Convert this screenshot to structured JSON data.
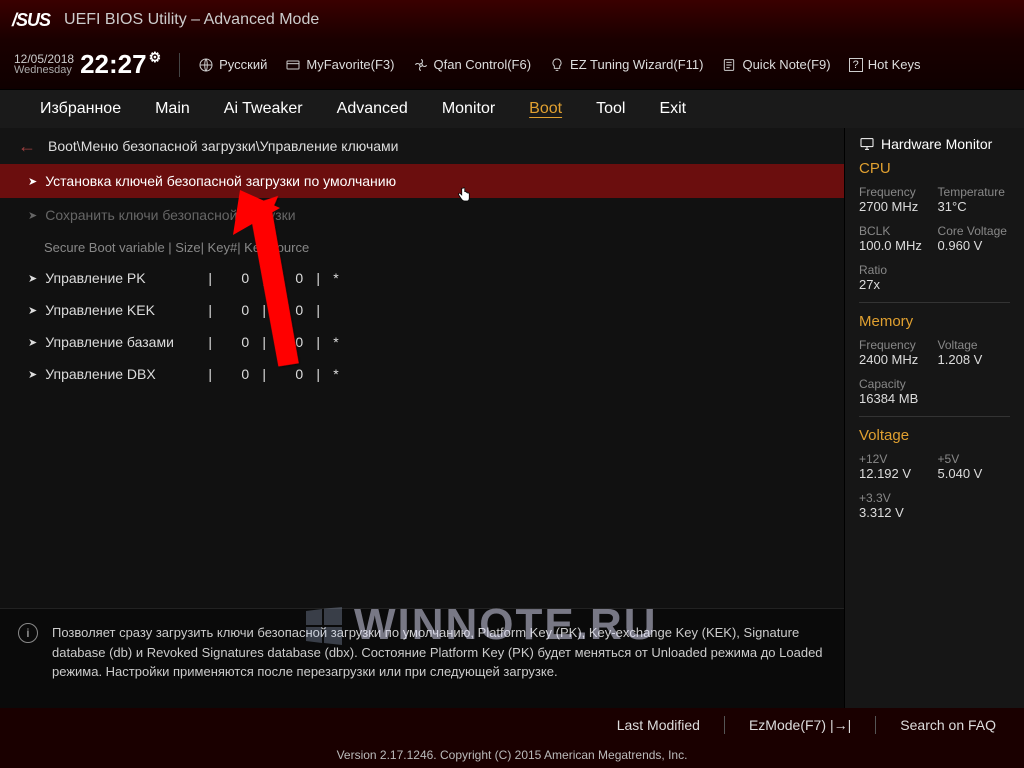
{
  "brand": "/SUS",
  "title": "UEFI BIOS Utility – Advanced Mode",
  "date": "12/05/2018",
  "day": "Wednesday",
  "time": "22:27",
  "toolbar": {
    "language": "Русский",
    "fav": "MyFavorite(F3)",
    "qfan": "Qfan Control(F6)",
    "ez": "EZ Tuning Wizard(F11)",
    "qnote": "Quick Note(F9)",
    "hotkeys": "Hot Keys"
  },
  "tabs": [
    "Избранное",
    "Main",
    "Ai Tweaker",
    "Advanced",
    "Monitor",
    "Boot",
    "Tool",
    "Exit"
  ],
  "active_tab": "Boot",
  "breadcrumb": "Boot\\Меню безопасной загрузки\\Управление ключами",
  "menu": {
    "item1": "Установка ключей безопасной загрузки по умолчанию",
    "item2": "Сохранить ключи безопасной загрузки",
    "header": "Secure Boot variable |  Size| Key#| Key source",
    "r1": {
      "label": "Управление PK",
      "s": "0",
      "k": "0",
      "src": "*"
    },
    "r2": {
      "label": "Управление KEK",
      "s": "0",
      "k": "0",
      "src": ""
    },
    "r3": {
      "label": "Управление базами",
      "s": "0",
      "k": "0",
      "src": "*"
    },
    "r4": {
      "label": "Управление DBX",
      "s": "0",
      "k": "0",
      "src": "*"
    }
  },
  "help": "Позволяет сразу загрузить ключи безопасной загрузки по умолчанию, Platform Key (PK), Key-exchange Key (KEK), Signature database (db) и Revoked Signatures database (dbx). Состояние Platform Key (PK) будет меняться от Unloaded режима до Loaded режима. Настройки применяются после перезагрузки или при следующей загрузке.",
  "hw": {
    "title": "Hardware Monitor",
    "cpu": {
      "title": "CPU",
      "freq_l": "Frequency",
      "freq_v": "2700 MHz",
      "temp_l": "Temperature",
      "temp_v": "31°C",
      "bclk_l": "BCLK",
      "bclk_v": "100.0 MHz",
      "cv_l": "Core Voltage",
      "cv_v": "0.960 V",
      "ratio_l": "Ratio",
      "ratio_v": "27x"
    },
    "mem": {
      "title": "Memory",
      "freq_l": "Frequency",
      "freq_v": "2400 MHz",
      "volt_l": "Voltage",
      "volt_v": "1.208 V",
      "cap_l": "Capacity",
      "cap_v": "16384 MB"
    },
    "volt": {
      "title": "Voltage",
      "v12_l": "+12V",
      "v12_v": "12.192 V",
      "v5_l": "+5V",
      "v5_v": "5.040 V",
      "v33_l": "+3.3V",
      "v33_v": "3.312 V"
    }
  },
  "footer": {
    "last": "Last Modified",
    "ez": "EzMode(F7)",
    "faq": "Search on FAQ",
    "version": "Version 2.17.1246. Copyright (C) 2015 American Megatrends, Inc."
  },
  "watermark": "WINNOTE.RU"
}
